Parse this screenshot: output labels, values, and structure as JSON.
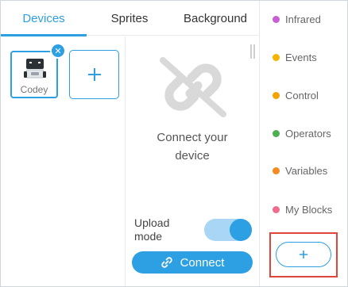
{
  "tabs": [
    {
      "label": "Devices",
      "active": true
    },
    {
      "label": "Sprites",
      "active": false
    },
    {
      "label": "Background",
      "active": false
    }
  ],
  "device": {
    "name": "Codey"
  },
  "connect": {
    "message_line1": "Connect your",
    "message_line2": "device",
    "upload_label_line1": "Upload",
    "upload_label_line2": "mode",
    "upload_mode_on": true,
    "button_label": "Connect"
  },
  "categories": [
    {
      "label": "Infrared",
      "color": "#c85ed3"
    },
    {
      "label": "Events",
      "color": "#f5b400"
    },
    {
      "label": "Control",
      "color": "#f5a300"
    },
    {
      "label": "Operators",
      "color": "#4caf50"
    },
    {
      "label": "Variables",
      "color": "#f58a1f"
    },
    {
      "label": "My Blocks",
      "color": "#f06b8c"
    }
  ],
  "colors": {
    "accent": "#2d9fe3",
    "highlight": "#e0453a"
  }
}
